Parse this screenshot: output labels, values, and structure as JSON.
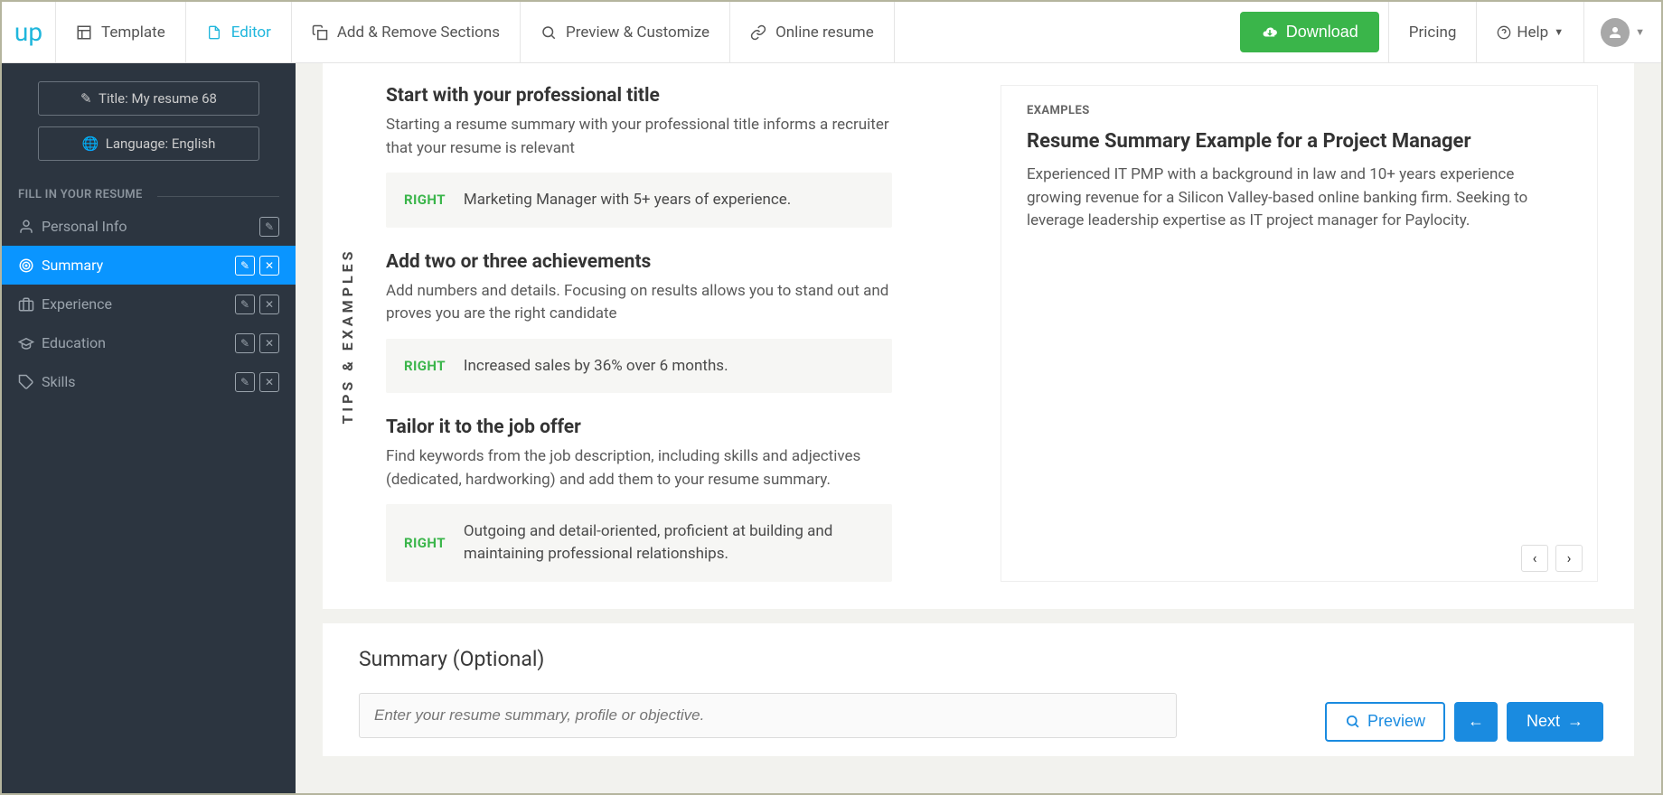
{
  "logo": "up",
  "topnav": {
    "template": "Template",
    "editor": "Editor",
    "add_remove": "Add & Remove Sections",
    "preview": "Preview & Customize",
    "online": "Online resume"
  },
  "actions": {
    "download": "Download",
    "pricing": "Pricing",
    "help": "Help"
  },
  "sidebar": {
    "title_btn": "Title: My resume 68",
    "lang_btn": "Language: English",
    "section_label": "FILL IN YOUR RESUME",
    "items": [
      {
        "label": "Personal Info",
        "edit": true,
        "close": false
      },
      {
        "label": "Summary",
        "edit": true,
        "close": true
      },
      {
        "label": "Experience",
        "edit": true,
        "close": true
      },
      {
        "label": "Education",
        "edit": true,
        "close": true
      },
      {
        "label": "Skills",
        "edit": true,
        "close": true
      }
    ]
  },
  "vertical_label": "TIPS & EXAMPLES",
  "tips": [
    {
      "title": "Start with your professional title",
      "text": "Starting a resume summary with your professional title informs a recruiter that your resume is relevant",
      "tag": "RIGHT",
      "example": "Marketing Manager with 5+ years of experience."
    },
    {
      "title": "Add two or three achievements",
      "text": "Add numbers and details. Focusing on results allows you to stand out and proves you are the right candidate",
      "tag": "RIGHT",
      "example": "Increased sales by 36% over 6 months."
    },
    {
      "title": "Tailor it to the job offer",
      "text": "Find keywords from the job description, including skills and adjectives (dedicated, hardworking) and add them to your resume summary.",
      "tag": "RIGHT",
      "example": "Outgoing and detail-oriented, proficient at building and maintaining professional relationships."
    }
  ],
  "examples": {
    "label": "EXAMPLES",
    "title": "Resume Summary Example for a Project Manager",
    "text": "Experienced IT PMP with a background in law and 10+ years experience growing revenue for a Silicon Valley-based online banking firm. Seeking to leverage leadership expertise as IT project manager for Paylocity."
  },
  "editor": {
    "heading": "Summary (Optional)",
    "placeholder": "Enter your resume summary, profile or objective."
  },
  "footer": {
    "preview": "Preview",
    "next": "Next"
  }
}
